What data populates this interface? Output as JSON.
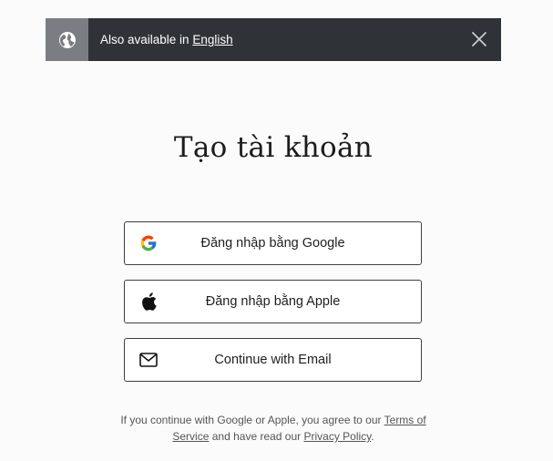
{
  "banner": {
    "prefix": "Also available in",
    "language_link": "English",
    "icon": "globe-icon",
    "close_icon": "close-icon"
  },
  "title": "Tạo tài khoản",
  "buttons": {
    "google": {
      "label": "Đăng nhập bằng Google",
      "icon": "google-icon"
    },
    "apple": {
      "label": "Đăng nhập bằng Apple",
      "icon": "apple-icon"
    },
    "email": {
      "label": "Continue with Email",
      "icon": "envelope-icon"
    }
  },
  "legal": {
    "text1": "If you continue with Google or Apple, you agree to our",
    "terms_link": "Terms of Service",
    "text2": "and have read our",
    "privacy_link": "Privacy Policy",
    "text3": "."
  },
  "colors": {
    "banner_bg": "#2f3338",
    "banner_icon_bg": "#7a7d82",
    "page_bg": "#fbfbfb",
    "button_border": "#3f3f3f"
  }
}
